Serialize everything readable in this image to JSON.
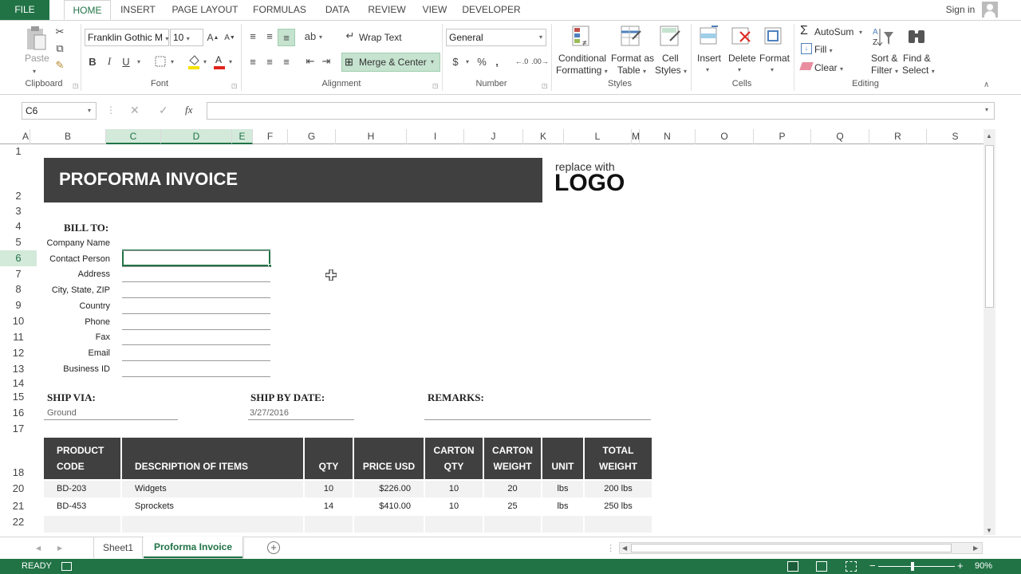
{
  "ribbon_tabs": [
    "FILE",
    "HOME",
    "INSERT",
    "PAGE LAYOUT",
    "FORMULAS",
    "DATA",
    "REVIEW",
    "VIEW",
    "DEVELOPER"
  ],
  "sign_in": "Sign in",
  "clipboard": {
    "paste": "Paste",
    "group": "Clipboard"
  },
  "font": {
    "name": "Franklin Gothic M",
    "size": "10",
    "bold": "B",
    "italic": "I",
    "underline": "U",
    "group": "Font"
  },
  "alignment": {
    "wrap": "Wrap Text",
    "merge": "Merge & Center",
    "group": "Alignment"
  },
  "number": {
    "format": "General",
    "currency": "$",
    "percent": "%",
    "comma": ",",
    "inc": "←.0",
    "dec": ".00→",
    "group": "Number"
  },
  "styles": {
    "cond1": "Conditional",
    "cond2": "Formatting",
    "fmt1": "Format as",
    "fmt2": "Table",
    "cell1": "Cell",
    "cell2": "Styles",
    "group": "Styles"
  },
  "cells": {
    "insert": "Insert",
    "delete": "Delete",
    "format": "Format",
    "group": "Cells"
  },
  "editing": {
    "autosum": "AutoSum",
    "fill": "Fill",
    "clear": "Clear",
    "sort1": "Sort &",
    "sort2": "Filter",
    "find1": "Find &",
    "find2": "Select",
    "group": "Editing"
  },
  "name_box": "C6",
  "fx": "fx",
  "columns": [
    "A",
    "B",
    "C",
    "D",
    "E",
    "F",
    "G",
    "H",
    "I",
    "J",
    "K",
    "L",
    "M",
    "N",
    "O",
    "P",
    "Q",
    "R",
    "S"
  ],
  "rows": [
    "1",
    "2",
    "3",
    "4",
    "5",
    "6",
    "7",
    "8",
    "9",
    "10",
    "11",
    "12",
    "13",
    "14",
    "15",
    "16",
    "17",
    "18",
    "20",
    "21",
    "22"
  ],
  "invoice": {
    "title": "PROFORMA INVOICE",
    "logo_small": "replace with",
    "logo_big": "LOGO",
    "bill_to": "BILL TO:",
    "fields": [
      "Company Name",
      "Contact Person",
      "Address",
      "City, State, ZIP",
      "Country",
      "Phone",
      "Fax",
      "Email",
      "Business ID"
    ],
    "ship_via": "SHIP VIA:",
    "ship_via_value": "Ground",
    "ship_by": "SHIP BY DATE:",
    "ship_by_value": "3/27/2016",
    "remarks": "REMARKS:",
    "headers": {
      "code1": "PRODUCT",
      "code2": "CODE",
      "desc": "DESCRIPTION OF ITEMS",
      "qty": "QTY",
      "price": "PRICE USD",
      "cqty1": "CARTON",
      "cqty2": "QTY",
      "cw1": "CARTON",
      "cw2": "WEIGHT",
      "unit": "UNIT",
      "tw1": "TOTAL",
      "tw2": "WEIGHT"
    },
    "items": [
      {
        "code": "BD-203",
        "desc": "Widgets",
        "qty": "10",
        "price": "$226.00",
        "cqty": "10",
        "cw": "20",
        "unit": "lbs",
        "tw": "200 lbs"
      },
      {
        "code": "BD-453",
        "desc": "Sprockets",
        "qty": "14",
        "price": "$410.00",
        "cqty": "10",
        "cw": "25",
        "unit": "lbs",
        "tw": "250 lbs"
      }
    ]
  },
  "sheet_tabs": [
    "Sheet1",
    "Proforma Invoice"
  ],
  "status": {
    "ready": "READY",
    "zoom": "90%"
  },
  "colors": {
    "excel_green": "#217346",
    "header_dark": "#404040",
    "selection": "#d3e9da"
  }
}
